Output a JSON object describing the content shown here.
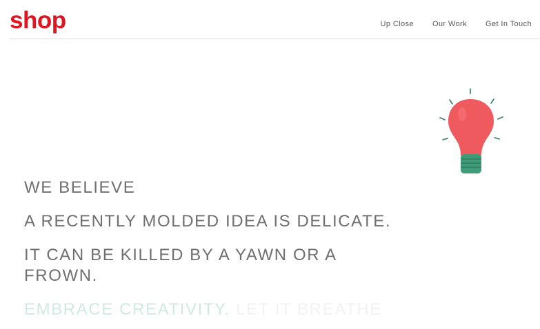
{
  "header": {
    "logo": "shop",
    "nav": [
      {
        "label": "Up Close"
      },
      {
        "label": "Our Work"
      },
      {
        "label": "Get In Touch"
      }
    ]
  },
  "hero": {
    "line1": "WE BELIEVE",
    "line2": "A RECENTLY MOLDED IDEA IS DELICATE.",
    "line3": "IT CAN BE KILLED BY A YAWN OR A FROWN.",
    "tagline_part1": "EMBRACE CREATIVITY.",
    "tagline_part2": " LET IT BREATHE"
  },
  "illustration": {
    "icon": "lightbulb-icon",
    "bulb_color": "#ef5a5e",
    "base_color": "#3f9b78",
    "ray_color": "#2f7a66"
  },
  "colors": {
    "brand": "#e3141f",
    "text": "#6f6f6f",
    "accent_faded": "#cfeae4"
  }
}
